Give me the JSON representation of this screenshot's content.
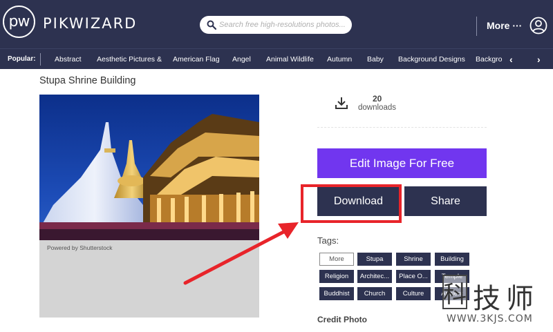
{
  "header": {
    "logo_mark": "pw",
    "logo_text": "PIKWIZARD",
    "search_placeholder": "Search free high-resolutions photos...",
    "more_label": "More ···",
    "colors": {
      "nav_bg": "#2d3250",
      "accent": "#7136ef"
    }
  },
  "categories": {
    "popular_label": "Popular:",
    "items": [
      "Abstract",
      "Aesthetic Pictures &",
      "American Flag",
      "Angel",
      "Animal Wildlife",
      "Autumn",
      "Baby",
      "Background Designs",
      "Backgro"
    ],
    "prev_icon": "chevron-left-icon",
    "next_icon": "chevron-right-icon"
  },
  "image": {
    "title": "Stupa Shrine Building",
    "powered_by": "Powered by Shutterstock"
  },
  "stats": {
    "downloads_count": "20",
    "downloads_label": "downloads"
  },
  "actions": {
    "edit_label": "Edit Image For Free",
    "download_label": "Download",
    "share_label": "Share"
  },
  "tags": {
    "label": "Tags:",
    "items": [
      "More",
      "Stupa",
      "Shrine",
      "Building",
      "Religion",
      "Architec...",
      "Place O...",
      "Temple",
      "Buddhist",
      "Church",
      "Culture",
      "Ancient"
    ]
  },
  "credit": {
    "label": "Credit Photo"
  },
  "watermark": {
    "box_char": "科",
    "chars": "技师",
    "url": "WWW.3KJS.COM"
  }
}
